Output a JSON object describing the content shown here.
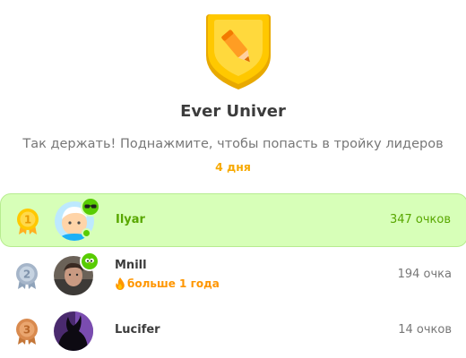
{
  "league": {
    "name": "Ever Univer",
    "subtitle": "Так держать! Поднажмите, чтобы попасть в тройку лидеров",
    "time_left": "4 дня"
  },
  "leaderboard": [
    {
      "rank": "1",
      "name": "Ilyar",
      "points": "347 очков",
      "streak": "",
      "highlighted": true
    },
    {
      "rank": "2",
      "name": "Mnill",
      "points": "194 очка",
      "streak": "больше 1 года",
      "highlighted": false
    },
    {
      "rank": "3",
      "name": "Lucifer",
      "points": "14 очков",
      "streak": "",
      "highlighted": false
    }
  ],
  "colors": {
    "highlight_bg": "#d7ffb8",
    "highlight_text": "#58a700",
    "gold": "#ffc800",
    "silver": "#a5b5c9",
    "bronze": "#d98a4e",
    "streak": "#ff9600",
    "days": "#f7a900"
  },
  "icons": {
    "league_badge": "gold-shield-pencil-icon",
    "medal_1": "gold-medal-icon",
    "medal_2": "silver-medal-icon",
    "medal_3": "bronze-medal-icon",
    "streak": "flame-icon"
  }
}
